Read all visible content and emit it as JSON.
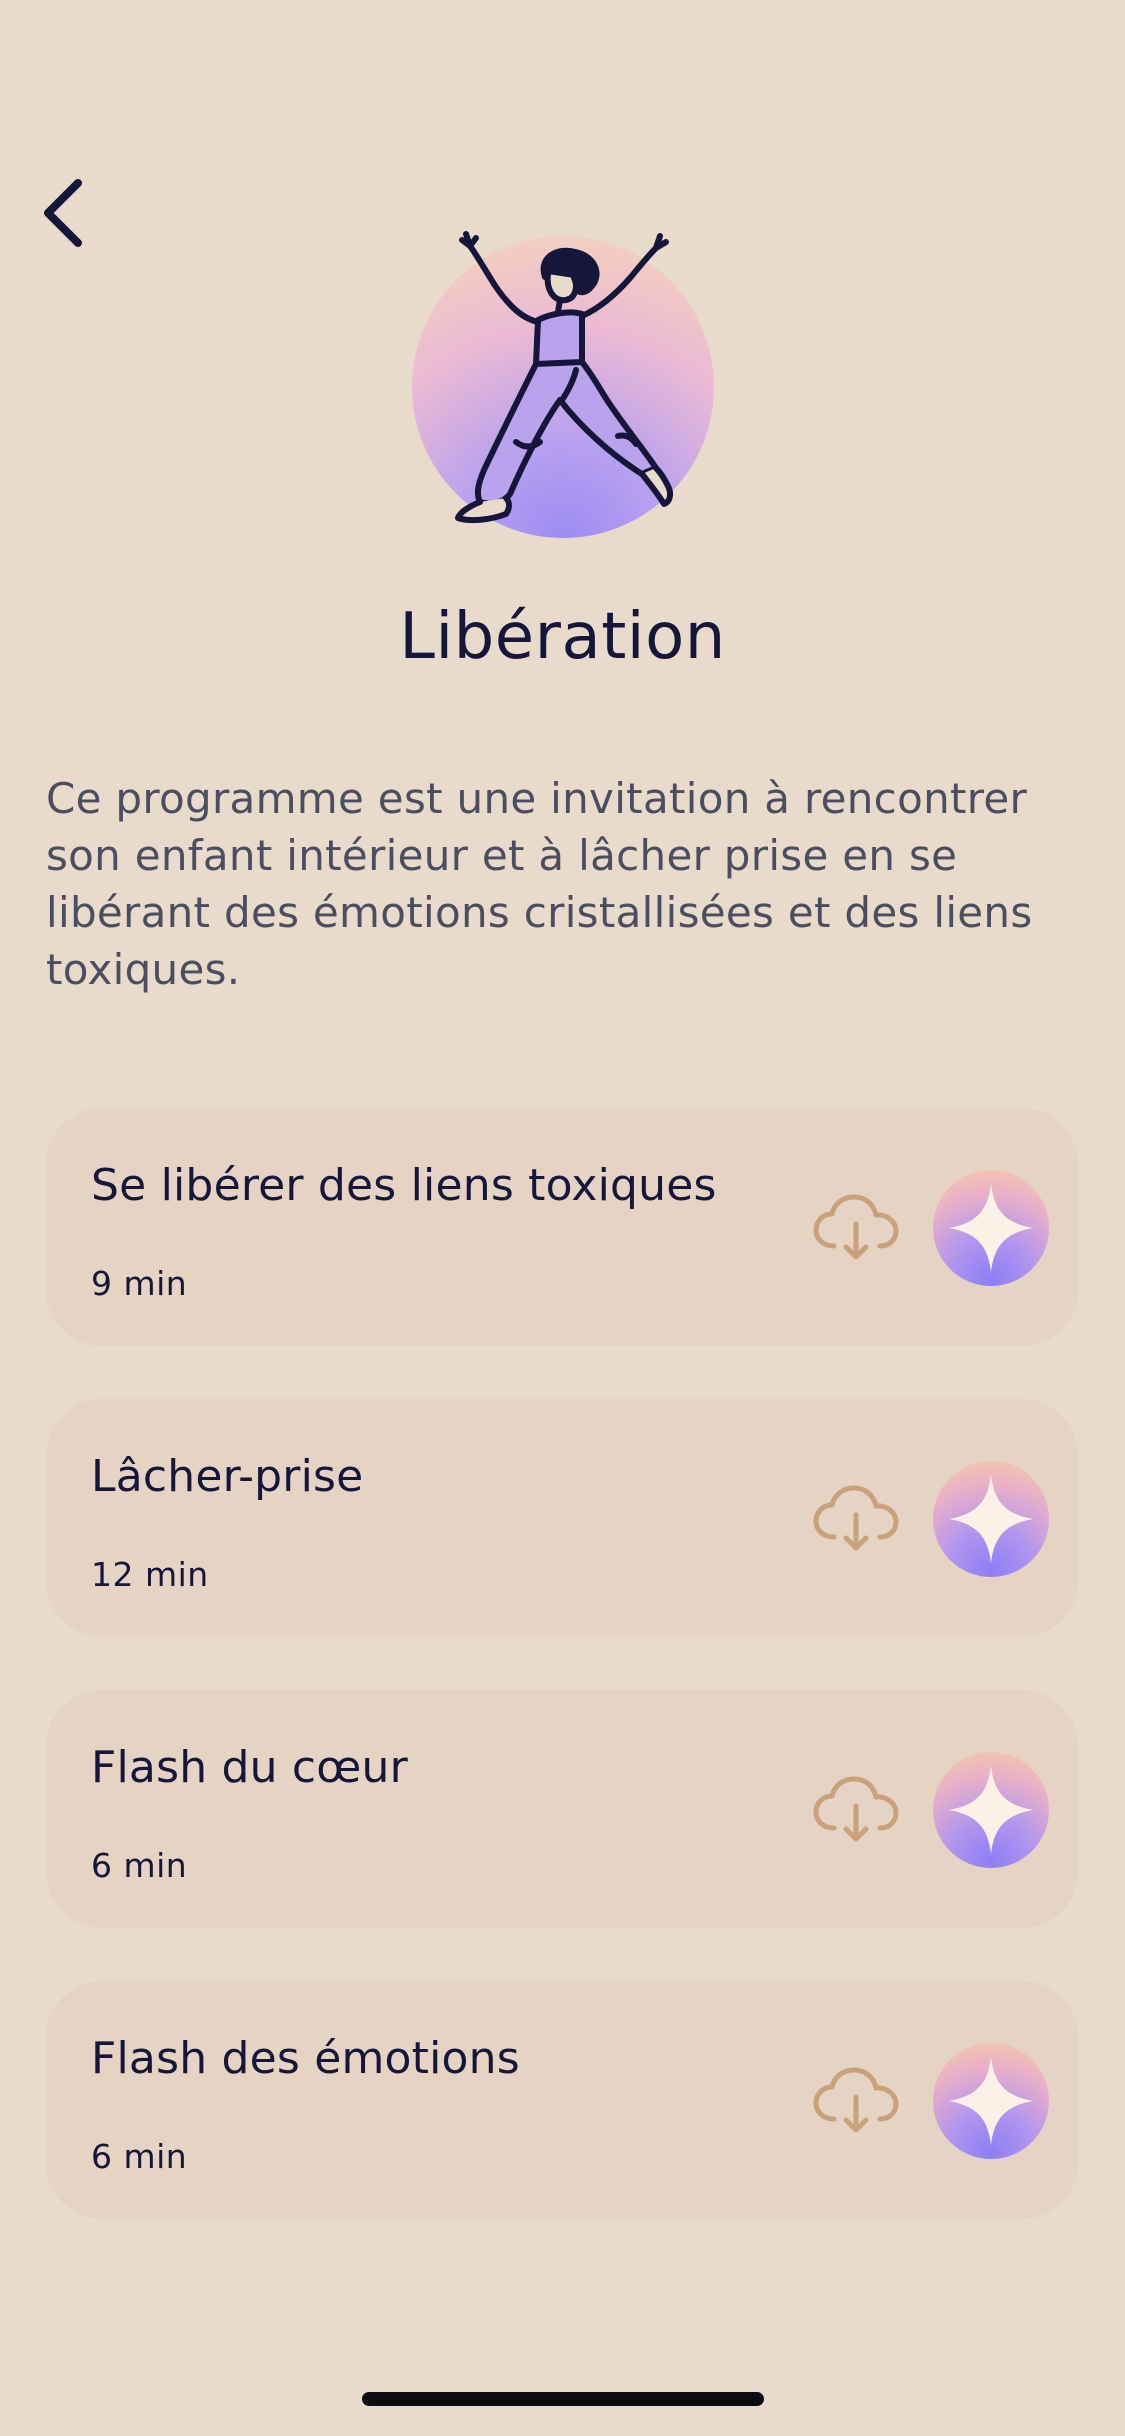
{
  "header": {
    "back_icon": "chevron-left-icon",
    "hero_illustration": "dancing-person-illustration"
  },
  "program": {
    "title": "Libération",
    "description": "Ce programme est une invitation à rencontrer son enfant intérieur et à lâcher prise en se libérant des émotions cristallisées et des liens toxiques."
  },
  "sessions": [
    {
      "title": "Se libérer des liens toxiques",
      "duration": "9 min",
      "download_icon": "cloud-download-icon",
      "play_icon": "sparkle-orb-icon"
    },
    {
      "title": "Lâcher-prise",
      "duration": "12 min",
      "download_icon": "cloud-download-icon",
      "play_icon": "sparkle-orb-icon"
    },
    {
      "title": "Flash du cœur",
      "duration": "6 min",
      "download_icon": "cloud-download-icon",
      "play_icon": "sparkle-orb-icon"
    },
    {
      "title": "Flash des émotions",
      "duration": "6 min",
      "download_icon": "cloud-download-icon",
      "play_icon": "sparkle-orb-icon"
    }
  ],
  "colors": {
    "background": "#e9dbcb",
    "card": "#e5d3c3",
    "text_dark": "#15163a",
    "text_muted": "#4b4d60",
    "download_icon": "#c9a27c",
    "orb_purple": "#8b7ef5",
    "orb_peach": "#f7cfa3"
  }
}
